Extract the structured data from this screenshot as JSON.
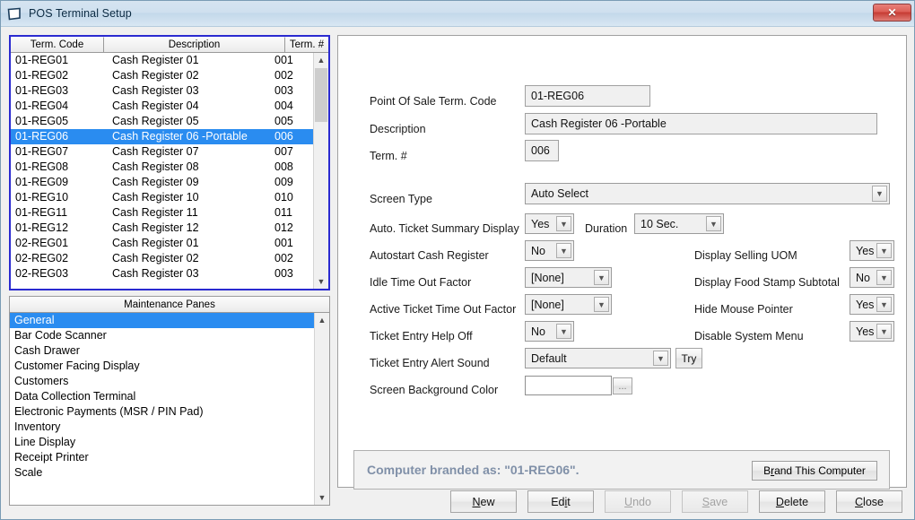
{
  "window": {
    "title": "POS Terminal Setup",
    "icon": "window-page-icon",
    "close_label": "✕"
  },
  "terminal_grid": {
    "columns": [
      "Term. Code",
      "Description",
      "Term. #"
    ],
    "selected_index": 5,
    "rows": [
      {
        "code": "01-REG01",
        "description": "Cash Register 01",
        "num": "001"
      },
      {
        "code": "01-REG02",
        "description": "Cash Register 02",
        "num": "002"
      },
      {
        "code": "01-REG03",
        "description": "Cash Register 03",
        "num": "003"
      },
      {
        "code": "01-REG04",
        "description": "Cash Register 04",
        "num": "004"
      },
      {
        "code": "01-REG05",
        "description": "Cash Register 05",
        "num": "005"
      },
      {
        "code": "01-REG06",
        "description": "Cash Register 06 -Portable",
        "num": "006"
      },
      {
        "code": "01-REG07",
        "description": "Cash Register 07",
        "num": "007"
      },
      {
        "code": "01-REG08",
        "description": "Cash Register 08",
        "num": "008"
      },
      {
        "code": "01-REG09",
        "description": "Cash Register 09",
        "num": "009"
      },
      {
        "code": "01-REG10",
        "description": "Cash Register 10",
        "num": "010"
      },
      {
        "code": "01-REG11",
        "description": "Cash Register 11",
        "num": "011"
      },
      {
        "code": "01-REG12",
        "description": "Cash Register 12",
        "num": "012"
      },
      {
        "code": "02-REG01",
        "description": "Cash Register 01",
        "num": "001"
      },
      {
        "code": "02-REG02",
        "description": "Cash Register 02",
        "num": "002"
      },
      {
        "code": "02-REG03",
        "description": "Cash Register 03",
        "num": "003"
      }
    ]
  },
  "maintenance_panes": {
    "header": "Maintenance Panes",
    "selected_index": 0,
    "items": [
      "General",
      "Bar Code Scanner",
      "Cash Drawer",
      "Customer Facing Display",
      "Customers",
      "Data Collection Terminal",
      "Electronic Payments (MSR / PIN Pad)",
      "Inventory",
      "Line Display",
      "Receipt Printer",
      "Scale"
    ]
  },
  "form": {
    "term_code_label": "Point Of Sale Term. Code",
    "term_code_value": "01-REG06",
    "description_label": "Description",
    "description_value": "Cash Register 06 -Portable",
    "term_num_label": "Term. #",
    "term_num_value": "006",
    "screen_type_label": "Screen Type",
    "screen_type_value": "Auto Select",
    "auto_ticket_label": "Auto. Ticket Summary Display",
    "auto_ticket_value": "Yes",
    "duration_label": "Duration",
    "duration_value": "10 Sec.",
    "autostart_label": "Autostart Cash Register",
    "autostart_value": "No",
    "idle_timeout_label": "Idle Time Out Factor",
    "idle_timeout_value": "[None]",
    "active_timeout_label": "Active Ticket Time Out Factor",
    "active_timeout_value": "[None]",
    "help_off_label": "Ticket Entry Help Off",
    "help_off_value": "No",
    "alert_sound_label": "Ticket Entry Alert Sound",
    "alert_sound_value": "Default",
    "try_label": "Try",
    "bg_color_label": "Screen Background Color",
    "bg_color_value": "",
    "bg_color_browse_label": "...",
    "selling_uom_label": "Display Selling UOM",
    "selling_uom_value": "Yes",
    "food_stamp_label": "Display Food Stamp Subtotal",
    "food_stamp_value": "No",
    "hide_pointer_label": "Hide Mouse Pointer",
    "hide_pointer_value": "Yes",
    "disable_menu_label": "Disable System Menu",
    "disable_menu_value": "Yes"
  },
  "branding": {
    "message": "Computer branded as: \"01-REG06\".",
    "button_prefix": "B",
    "button_accel": "r",
    "button_suffix": "and This Computer"
  },
  "footer_buttons": [
    {
      "accel": "N",
      "rest": "ew",
      "pre": "",
      "disabled": false,
      "name": "new-button"
    },
    {
      "accel": "i",
      "rest": "t",
      "pre": "Ed",
      "disabled": false,
      "name": "edit-button"
    },
    {
      "accel": "U",
      "rest": "ndo",
      "pre": "",
      "disabled": true,
      "name": "undo-button"
    },
    {
      "accel": "S",
      "rest": "ave",
      "pre": "",
      "disabled": true,
      "name": "save-button"
    },
    {
      "accel": "D",
      "rest": "elete",
      "pre": "",
      "disabled": false,
      "name": "delete-button"
    },
    {
      "accel": "C",
      "rest": "lose",
      "pre": "",
      "disabled": false,
      "name": "close-button"
    }
  ],
  "colors": {
    "selection": "#2a8cf0",
    "grid_border": "#2a2ad0",
    "brand_text": "#8090a8",
    "close_button": "#c63b33"
  }
}
